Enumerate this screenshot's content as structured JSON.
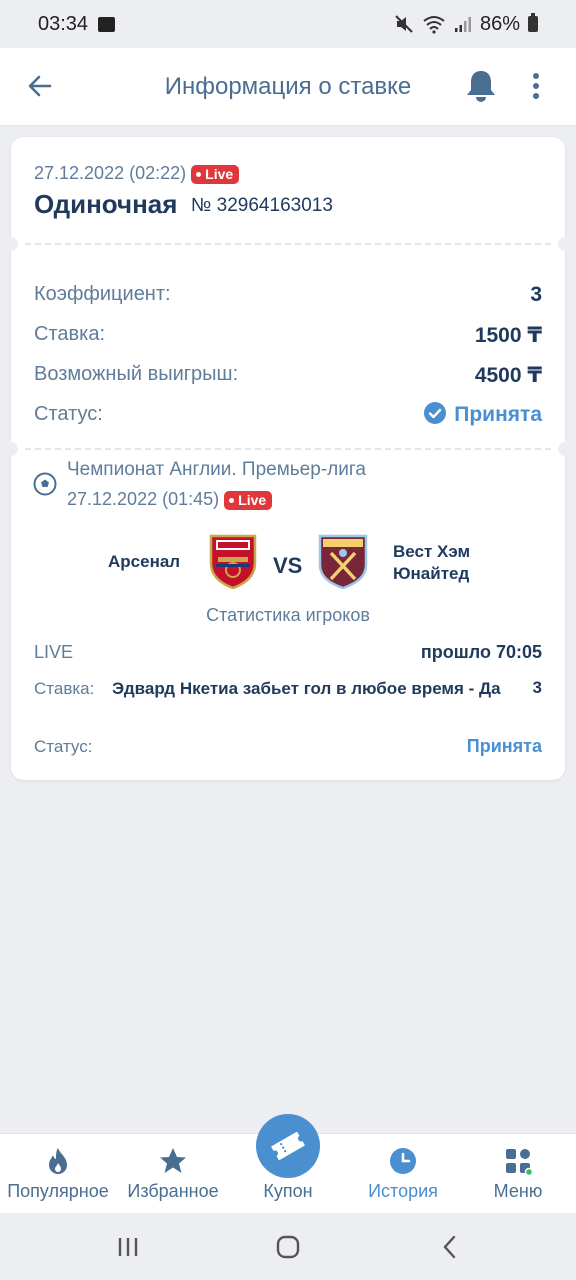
{
  "status_bar": {
    "time": "03:34",
    "battery": "86%"
  },
  "header": {
    "title": "Информация о ставке"
  },
  "bet": {
    "date": "27.12.2022 (02:22)",
    "live_badge": "Live",
    "type": "Одиночная",
    "number": "№ 32964163013",
    "rows": [
      {
        "label": "Коэффициент:",
        "value": "3"
      },
      {
        "label": "Ставка:",
        "value": "1500 ₸"
      },
      {
        "label": "Возможный выигрыш:",
        "value": "4500 ₸"
      },
      {
        "label": "Статус:",
        "value": "Принята"
      }
    ]
  },
  "event": {
    "league": "Чемпионат Англии. Премьер-лига",
    "date": "27.12.2022 (01:45)",
    "live_badge": "Live",
    "home_team": "Арсенал",
    "vs": "VS",
    "away_team": "Вест Хэм Юнайтед",
    "stats_link": "Статистика игроков",
    "live_label": "LIVE",
    "elapsed": "прошло 70:05",
    "stake_label": "Ставка:",
    "stake_text": "Эдвард Нкетиа забьет гол в любое время - Да",
    "stake_odd": "3",
    "status_label": "Статус:",
    "status_value": "Принята"
  },
  "bottom_nav": {
    "items": [
      {
        "label": "Популярное",
        "icon": "flame-icon"
      },
      {
        "label": "Избранное",
        "icon": "star-icon"
      },
      {
        "label": "Купон",
        "icon": "ticket-icon"
      },
      {
        "label": "История",
        "icon": "clock-icon",
        "active": true
      },
      {
        "label": "Меню",
        "icon": "grid-icon"
      }
    ]
  },
  "colors": {
    "accent": "#4a8fd0",
    "text_dark": "#1f3a5c",
    "text_muted": "#5f7d9a",
    "live_red": "#e0373a",
    "background": "#eceef2"
  }
}
